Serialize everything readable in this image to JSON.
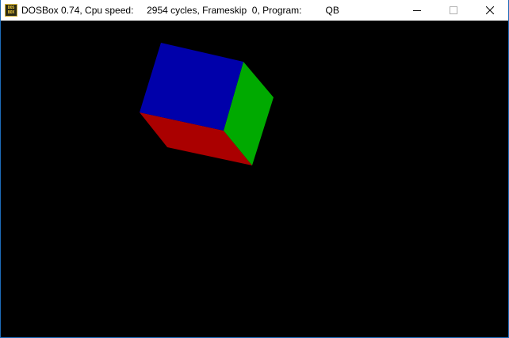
{
  "window": {
    "title_app": "DOSBox 0.74, Cpu speed:",
    "title_cycles": "2954 cycles, Frameskip  0, Program:",
    "title_program": "QB",
    "icon_text_top": "DOS",
    "icon_text_bottom": "BOX"
  },
  "controls": {
    "minimize_icon": "minimize-icon",
    "maximize_icon": "maximize-icon",
    "close_icon": "close-icon"
  },
  "scene": {
    "background_color": "#000000",
    "cube": {
      "top_face_color": "#0000aa",
      "right_face_color": "#00aa00",
      "front_face_color": "#aa0000"
    }
  }
}
